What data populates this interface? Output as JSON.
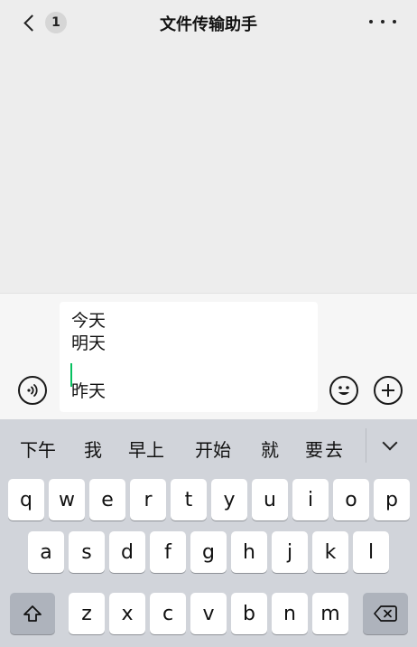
{
  "header": {
    "back_badge": "1",
    "title": "文件传输助手",
    "more_icon": "more-dots-icon"
  },
  "composer": {
    "lines": [
      "今天",
      "明天",
      "昨天"
    ],
    "caret_color": "#07c160",
    "voice_icon": "voice-icon",
    "emoji_icon": "emoji-icon",
    "plus_icon": "plus-icon"
  },
  "keyboard": {
    "candidates": [
      "下午",
      "我",
      "早上",
      "开始",
      "就",
      "要",
      "去"
    ],
    "collapse_icon": "chevron-down-icon",
    "row1": [
      "q",
      "w",
      "e",
      "r",
      "t",
      "y",
      "u",
      "i",
      "o",
      "p"
    ],
    "row2": [
      "a",
      "s",
      "d",
      "f",
      "g",
      "h",
      "j",
      "k",
      "l"
    ],
    "row3": [
      "z",
      "x",
      "c",
      "v",
      "b",
      "n",
      "m"
    ],
    "shift_icon": "shift-icon",
    "backspace_icon": "backspace-icon"
  }
}
